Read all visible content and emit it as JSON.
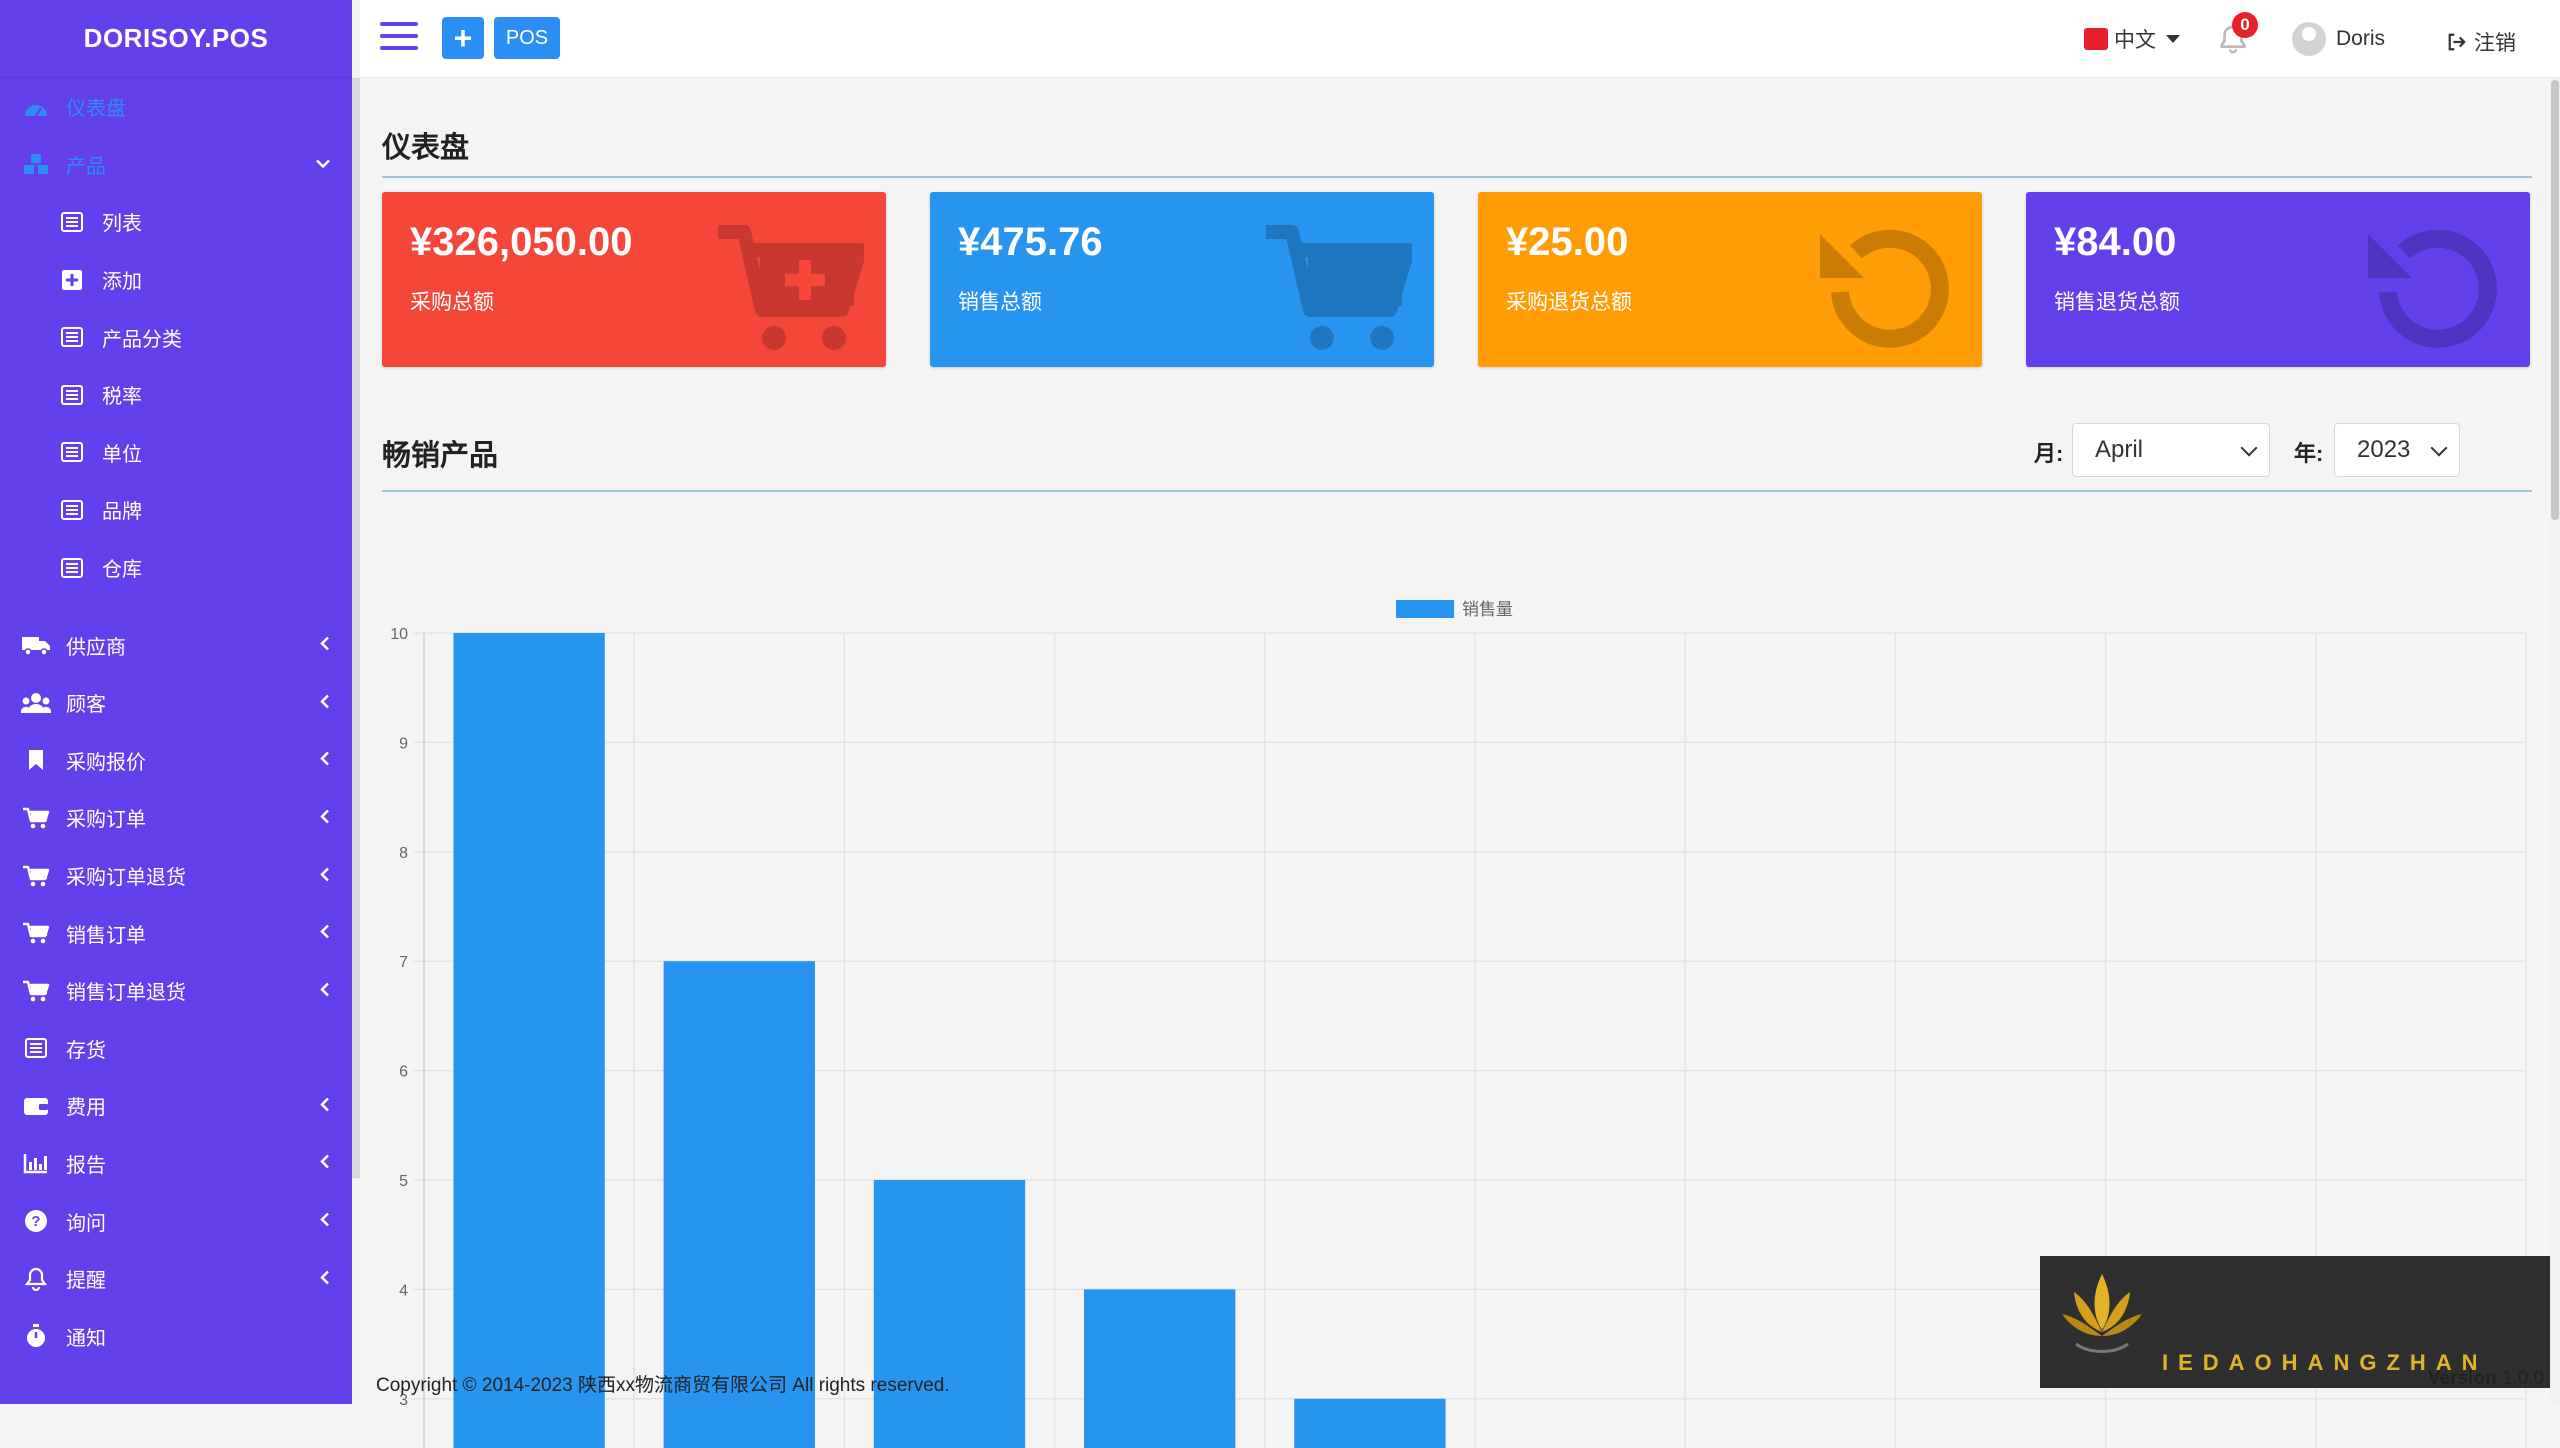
{
  "app": {
    "brand": "DORISOY.POS"
  },
  "topbar": {
    "pos_label": "POS",
    "language": "中文",
    "notification_count": "0",
    "username": "Doris",
    "logout_label": "注销"
  },
  "sidebar": {
    "items": [
      {
        "label": "仪表盘",
        "icon": "dashboard-icon",
        "state": "active"
      },
      {
        "label": "产品",
        "icon": "cubes-icon",
        "state": "open"
      },
      {
        "label": "列表",
        "icon": "list-icon",
        "sub": true
      },
      {
        "label": "添加",
        "icon": "plus-square-icon",
        "sub": true
      },
      {
        "label": "产品分类",
        "icon": "list-icon",
        "sub": true
      },
      {
        "label": "税率",
        "icon": "list-icon",
        "sub": true
      },
      {
        "label": "单位",
        "icon": "list-icon",
        "sub": true
      },
      {
        "label": "品牌",
        "icon": "list-icon",
        "sub": true
      },
      {
        "label": "仓库",
        "icon": "list-icon",
        "sub": true
      },
      {
        "label": "供应商",
        "icon": "truck-icon"
      },
      {
        "label": "顾客",
        "icon": "users-icon"
      },
      {
        "label": "采购报价",
        "icon": "bookmark-icon"
      },
      {
        "label": "采购订单",
        "icon": "cart-icon"
      },
      {
        "label": "采购订单退货",
        "icon": "cart-icon"
      },
      {
        "label": "销售订单",
        "icon": "cart-icon"
      },
      {
        "label": "销售订单退货",
        "icon": "cart-icon"
      },
      {
        "label": "存货",
        "icon": "list-icon"
      },
      {
        "label": "费用",
        "icon": "wallet-icon"
      },
      {
        "label": "报告",
        "icon": "bar-chart-icon"
      },
      {
        "label": "询问",
        "icon": "question-icon"
      },
      {
        "label": "提醒",
        "icon": "bell-icon"
      },
      {
        "label": "通知",
        "icon": "stopwatch-icon"
      }
    ]
  },
  "dashboard": {
    "title": "仪表盘",
    "cards": [
      {
        "amount": "¥326,050.00",
        "label": "采购总额",
        "color": "#f4473a",
        "icon": "cart-plus-icon"
      },
      {
        "amount": "¥475.76",
        "label": "销售总额",
        "color": "#2794ef",
        "icon": "cart-icon"
      },
      {
        "amount": "¥25.00",
        "label": "采购退货总额",
        "color": "#ff9c06",
        "icon": "undo-icon"
      },
      {
        "amount": "¥84.00",
        "label": "销售退货总额",
        "color": "#6440ec",
        "icon": "undo-icon"
      }
    ],
    "bestsellers": {
      "title": "畅销产品",
      "month_label": "月:",
      "month_value": "April",
      "year_label": "年:",
      "year_value": "2023"
    }
  },
  "chart_data": {
    "type": "bar",
    "series": [
      {
        "name": "销售量",
        "values": [
          10,
          7,
          5,
          4,
          3,
          null,
          null,
          null,
          null,
          null
        ],
        "color": "#2794ef"
      }
    ],
    "categories": [
      "",
      "",
      "",
      "",
      "",
      "",
      "",
      "",
      "",
      ""
    ],
    "y_ticks": [
      3,
      4,
      5,
      6,
      7,
      8,
      9,
      10
    ],
    "ylim": [
      2.55,
      10
    ],
    "grid": true,
    "legend_position": "top-center"
  },
  "footer": {
    "copyright": "Copyright © 2014-2023 陕西xx物流商贸有限公司 All rights reserved.",
    "version_label": "Version",
    "version_value": "1.0.0"
  },
  "watermark": {
    "text": "IEDAOHANGZHAN"
  }
}
